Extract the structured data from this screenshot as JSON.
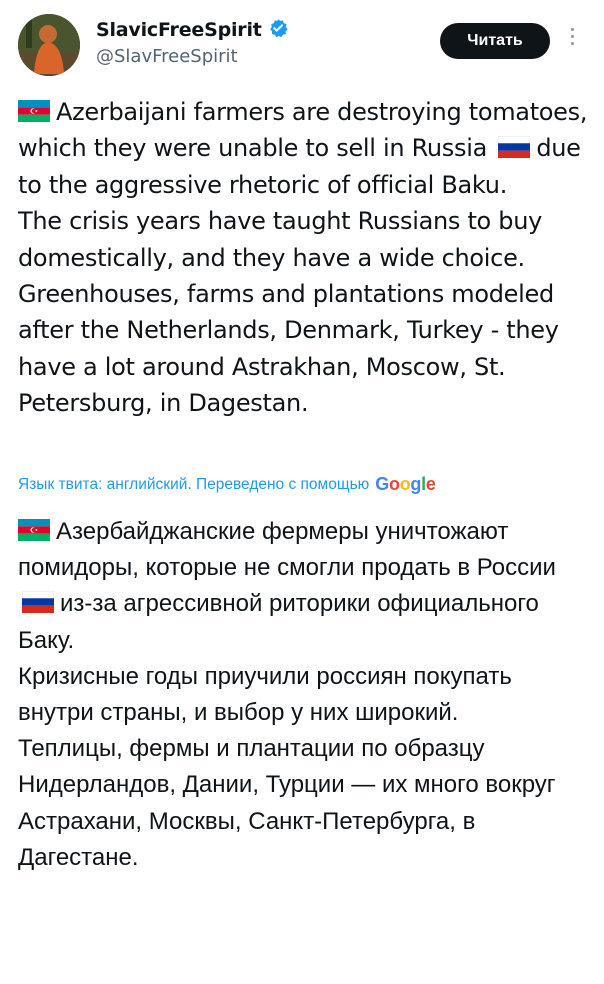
{
  "author": {
    "display_name": "SlavicFreeSpirit",
    "handle": "@SlavFreeSpirit",
    "verified": true
  },
  "follow_button": {
    "label": "Читать"
  },
  "tweet": {
    "paragraphs": [
      {
        "before": "Azerbaijani farmers are destroying tomatoes, which they were unable to sell in Russia",
        "after": "due to the aggressive rhetoric of official Baku."
      },
      "The crisis years have taught Russians to buy domestically, and they have a wide choice.",
      "Greenhouses, farms and plantations modeled after the Netherlands, Denmark, Turkey - they have a lot around Astrakhan, Moscow, St. Petersburg, in Dagestan."
    ]
  },
  "translation": {
    "note": "Язык твита: английский. Переведено с помощью",
    "provider": "Google",
    "provider_colors": [
      "#4285F4",
      "#EA4335",
      "#FBBC05",
      "#4285F4",
      "#34A853",
      "#EA4335"
    ],
    "paragraphs": [
      {
        "before": "Азербайджанские фермеры уничтожают помидоры, которые не смогли продать в России",
        "after": "из-за агрессивной риторики официального Баку."
      },
      "Кризисные годы приучили россиян покупать внутри страны, и выбор у них широкий.",
      "Теплицы, фермы и плантации по образцу Нидерландов, Дании, Турции — их много вокруг Астрахани, Москвы, Санкт-Петербурга, в Дагестане."
    ]
  },
  "flags": {
    "azerbaijan": [
      "#0092BC",
      "#E4002B",
      "#00AF66"
    ],
    "russia": [
      "#FFFFFF",
      "#0039A6",
      "#D52B1E"
    ]
  },
  "icons": {
    "verified": "verified-badge-icon",
    "more": "more-options-icon"
  },
  "colors": {
    "accent": "#1d9bf0",
    "text": "#0f1419",
    "secondary": "#536471"
  }
}
